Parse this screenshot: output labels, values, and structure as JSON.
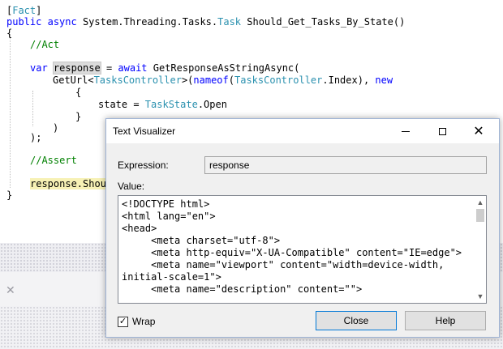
{
  "code": {
    "attribute_fact": "Fact",
    "kw_public": "public",
    "kw_async": "async",
    "method_prefix": "System.Threading.Tasks.",
    "task_type": "Task",
    "method_name": " Should_Get_Tasks_By_State()",
    "brace_open": "{",
    "comment_act": "//Act",
    "kw_var": "var",
    "var_response": "response",
    "assign_await": " = ",
    "kw_await": "await",
    "call_get_response": " GetResponseAsStringAsync(",
    "get_url": "GetUrl<",
    "controller_type": "TasksController",
    "kw_nameof": "nameof",
    "nameof_open": ">(",
    "nameof_arg_type": "TasksController",
    "nameof_member": ".Index), ",
    "kw_new": "new",
    "inner_brace_open": "{",
    "state_assign": "state = ",
    "enum_type": "TaskState",
    "enum_member": ".Open",
    "inner_brace_close": "}",
    "paren_close": ")",
    "stmt_end": ");",
    "comment_assert": "//Assert",
    "assert_response": "response",
    "assert_should": ".Shou",
    "brace_close": "}"
  },
  "dialog": {
    "title": "Text Visualizer",
    "expression_label": "Expression:",
    "expression_value": "response",
    "value_label": "Value:",
    "value_text": "<!DOCTYPE html>\n<html lang=\"en\">\n<head>\n     <meta charset=\"utf-8\">\n     <meta http-equiv=\"X-UA-Compatible\" content=\"IE=edge\">\n     <meta name=\"viewport\" content=\"width=device-width,\ninitial-scale=1\">\n     <meta name=\"description\" content=\"\">",
    "wrap_label": "Wrap",
    "wrap_checked": true,
    "close_button": "Close",
    "help_button": "Help"
  },
  "icons": {
    "minimize": "minimize-icon",
    "maximize": "maximize-icon",
    "close": "close-icon",
    "scroll_up": "chevron-up-icon",
    "scroll_down": "chevron-down-icon",
    "pane_close": "close-icon"
  }
}
